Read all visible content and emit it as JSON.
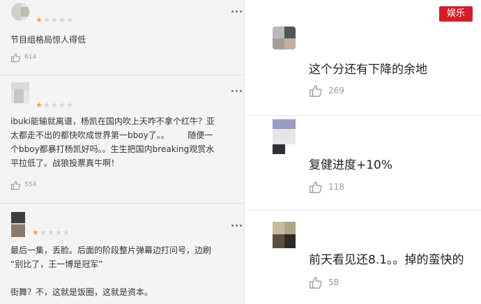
{
  "watermark": {
    "text": "娱乐"
  },
  "left_comments": [
    {
      "rating": 1,
      "text": "节目组格局惊人得低",
      "likes": "614"
    },
    {
      "rating": 1,
      "text": "ibuki能输就离谱，杨凯在国内吹上天咋不拿个红牛？亚\n太都走不出的都快吹成世界第一bboy了。。       随便一\n个bboy都暴打杨凯好吗。。生生把国内breaking观赏水\n平拉低了。战狼投票真牛啊！",
      "likes": "554"
    },
    {
      "rating": 1,
      "text": "最后一集，丢脸。后面的阶段整片弹幕边打问号，边刷\n“别比了，王一博是冠军”\n\n街舞？不，这就是饭圈，这就是资本。",
      "likes": ""
    }
  ],
  "right_comments": [
    {
      "text": "这个分还有下降的余地",
      "likes": "269"
    },
    {
      "text": "复健进度+10%",
      "likes": "118"
    },
    {
      "text": "前天看见还8.1。。掉的蛮快的",
      "likes": "58"
    }
  ],
  "colors": {
    "star_on": "#f3a51a",
    "star_off": "#d4d4d4",
    "watermark_bg": "#d21d26"
  },
  "icons": {
    "like": "thumbs-up-icon",
    "more": "more-dots-icon",
    "star": "star-icon"
  }
}
